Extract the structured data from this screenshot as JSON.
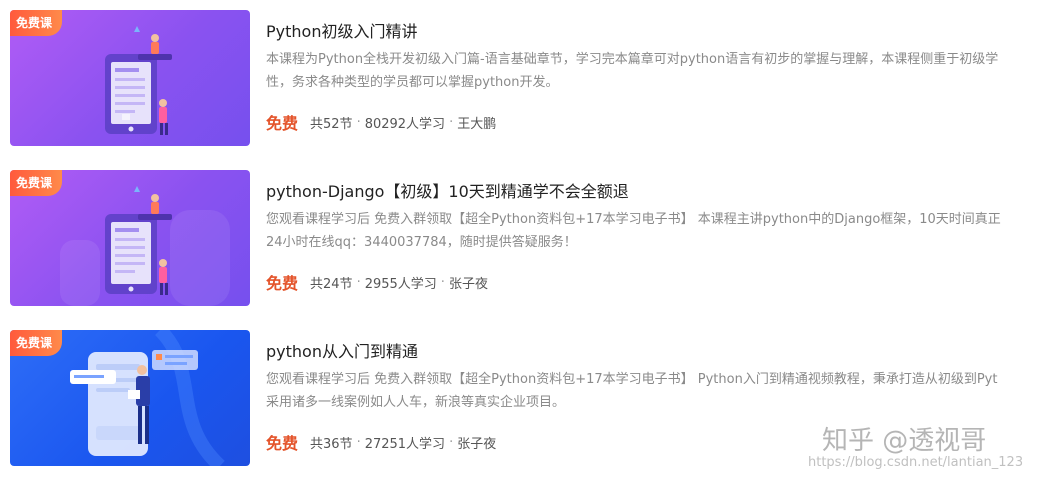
{
  "courses": [
    {
      "badge": "免费课",
      "title": "Python初级入门精讲",
      "desc_line1": "本课程为Python全栈开发初级入门篇-语言基础章节，学习完本篇章可对python语言有初步的掌握与理解，本课程侧重于初级学",
      "desc_line2": "性，务求各种类型的学员都可以掌握python开发。",
      "price": "免费",
      "lessons": "共52节",
      "learners": "80292人学习",
      "teacher": "王大鹏",
      "thumb_color": "#8a52f0"
    },
    {
      "badge": "免费课",
      "title": "python-Django【初级】10天到精通学不会全额退",
      "desc_line1": "您观看课程学习后 免费入群领取【超全Python资料包+17本学习电子书】 本课程主讲python中的Django框架，10天时间真正",
      "desc_line2": "24小时在线qq：3440037784，随时提供答疑服务！",
      "price": "免费",
      "lessons": "共24节",
      "learners": "2955人学习",
      "teacher": "张子夜",
      "thumb_color": "#8a52f0"
    },
    {
      "badge": "免费课",
      "title": "python从入门到精通",
      "desc_line1": "您观看课程学习后 免费入群领取【超全Python资料包+17本学习电子书】 Python入门到精通视频教程，秉承打造从初级到Pyt",
      "desc_line2": "采用诸多一线案例如人人车，新浪等真实企业项目。",
      "price": "免费",
      "lessons": "共36节",
      "learners": "27251人学习",
      "teacher": "张子夜",
      "thumb_color": "#1a56ef"
    }
  ],
  "separator": "·",
  "watermark": "知乎 @透视哥",
  "url_watermark": "https://blog.csdn.net/lantian_123"
}
